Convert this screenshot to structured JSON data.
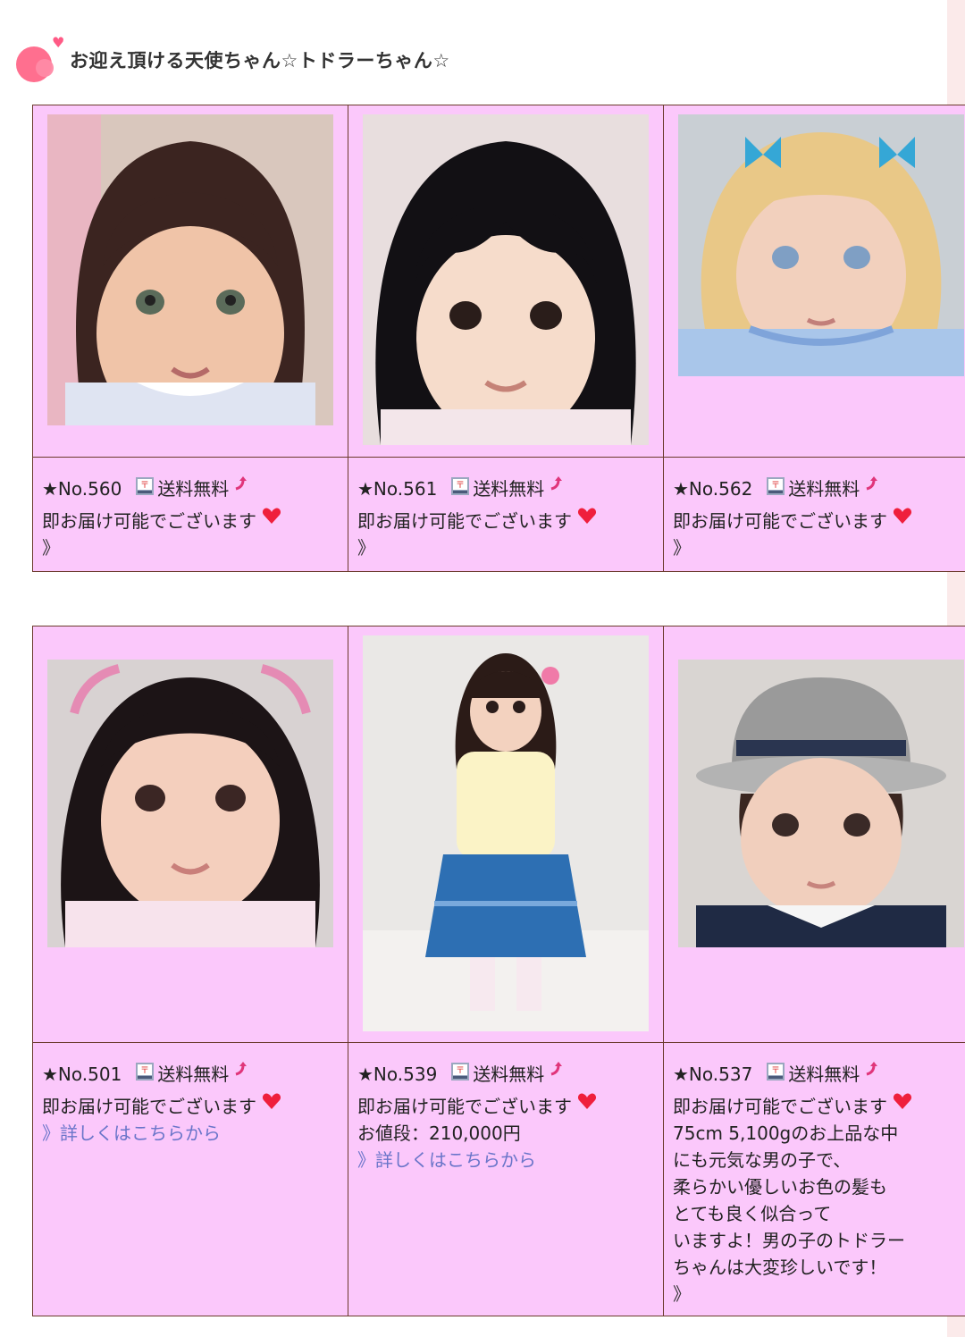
{
  "section_title": "お迎え頂ける天使ちゃん☆トドラーちゃん☆",
  "items": [
    {
      "no": "★No.560",
      "shipping": "送料無料",
      "available": "即お届け可能でございます",
      "link": "》",
      "price": "",
      "desc": ""
    },
    {
      "no": "★No.561",
      "shipping": "送料無料",
      "available": "即お届け可能でございます",
      "link": "》",
      "price": "",
      "desc": ""
    },
    {
      "no": "★No.562",
      "shipping": "送料無料",
      "available": "即お届け可能でございます",
      "link": "》",
      "price": "",
      "desc": ""
    },
    {
      "no": "★No.501",
      "shipping": "送料無料",
      "available": "即お届け可能でございます",
      "link": "》詳しくはこちらから",
      "price": "",
      "desc": ""
    },
    {
      "no": "★No.539",
      "shipping": "送料無料",
      "available": "即お届け可能でございます",
      "link": "》詳しくはこちらから",
      "price": "お値段：210,000円",
      "desc": ""
    },
    {
      "no": "★No.537",
      "shipping": "送料無料",
      "available": "即お届け可能でございます",
      "link": "》",
      "price": "",
      "desc": "75cm 5,100gのお上品な中\nにも元気な男の子で、\n柔らかい優しいお色の髪も\nとても良く似合って\nいますよ！男の子のトドラー\nちゃんは大変珍しいです！"
    }
  ],
  "icons": {
    "title": "pink-bubbles-icon",
    "shipping": "post-truck-icon",
    "arrow": "pink-arrow-icon",
    "heart": "red-heart-icon"
  },
  "colors": {
    "cell_bg": "#fbc8fb",
    "border": "#6b3a2c",
    "link": "#6a75c9",
    "accent": "#ff5a85"
  }
}
